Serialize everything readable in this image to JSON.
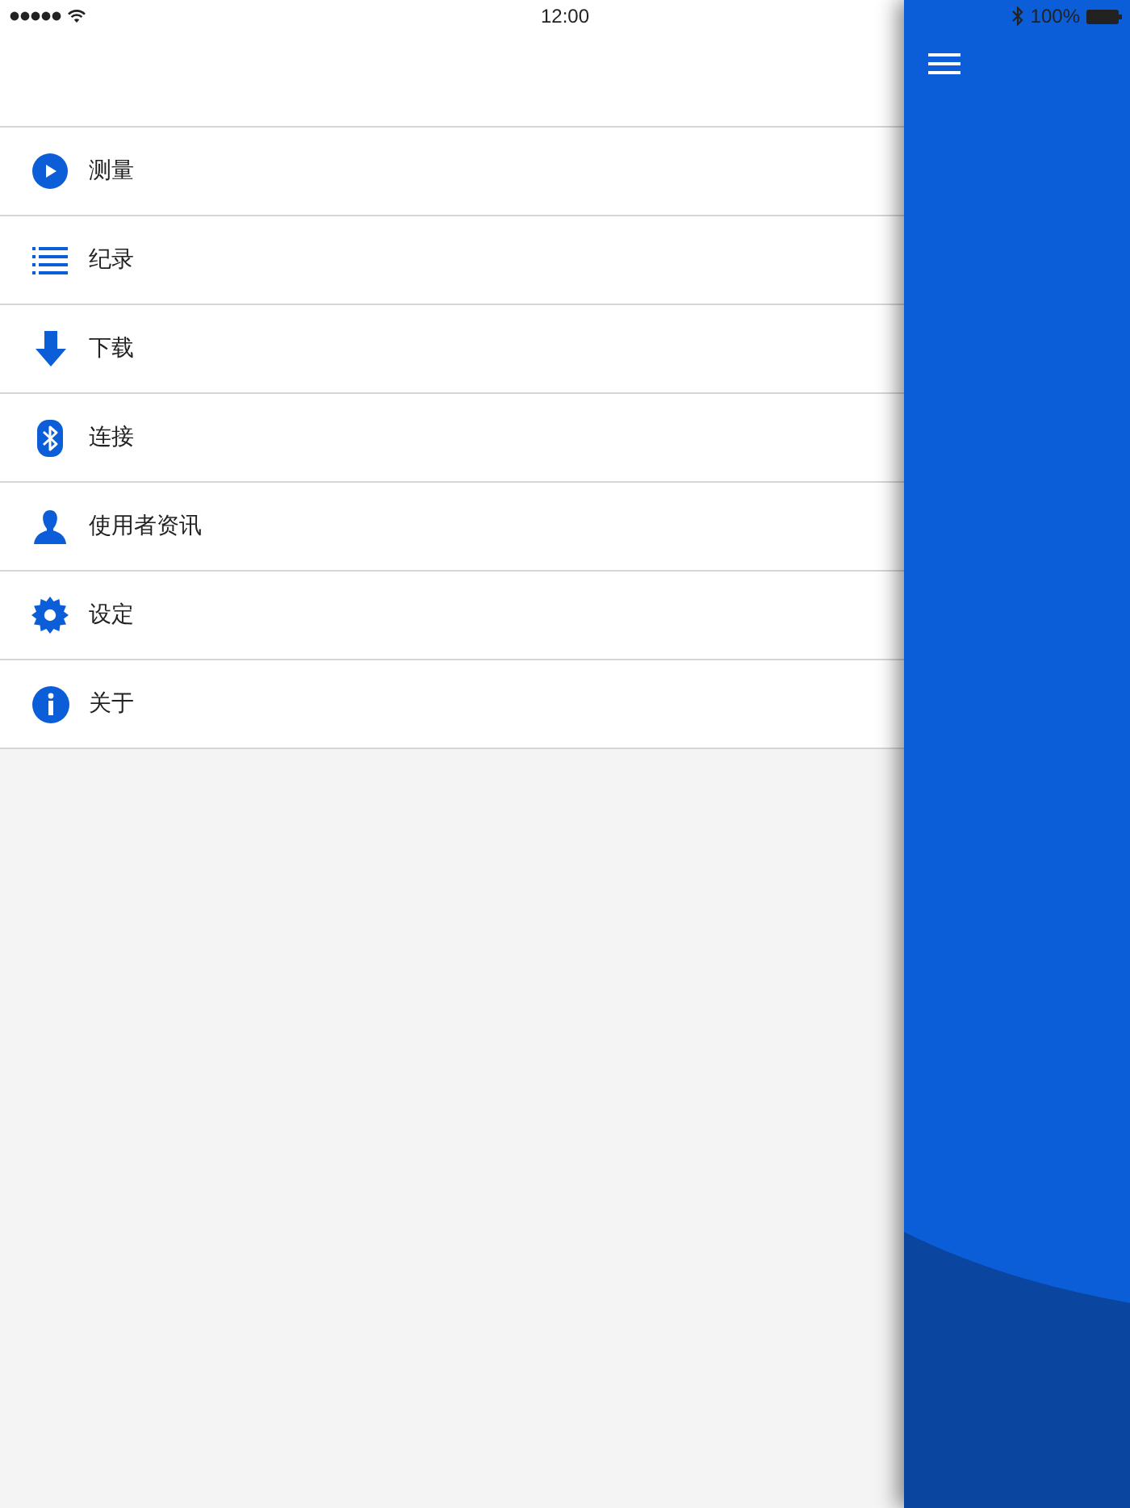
{
  "status_bar": {
    "time": "12:00",
    "battery_text": "100%"
  },
  "menu": {
    "items": [
      {
        "label": "测量"
      },
      {
        "label": "纪录"
      },
      {
        "label": "下载"
      },
      {
        "label": "连接"
      },
      {
        "label": "使用者资讯"
      },
      {
        "label": "设定"
      },
      {
        "label": "关于"
      }
    ]
  }
}
